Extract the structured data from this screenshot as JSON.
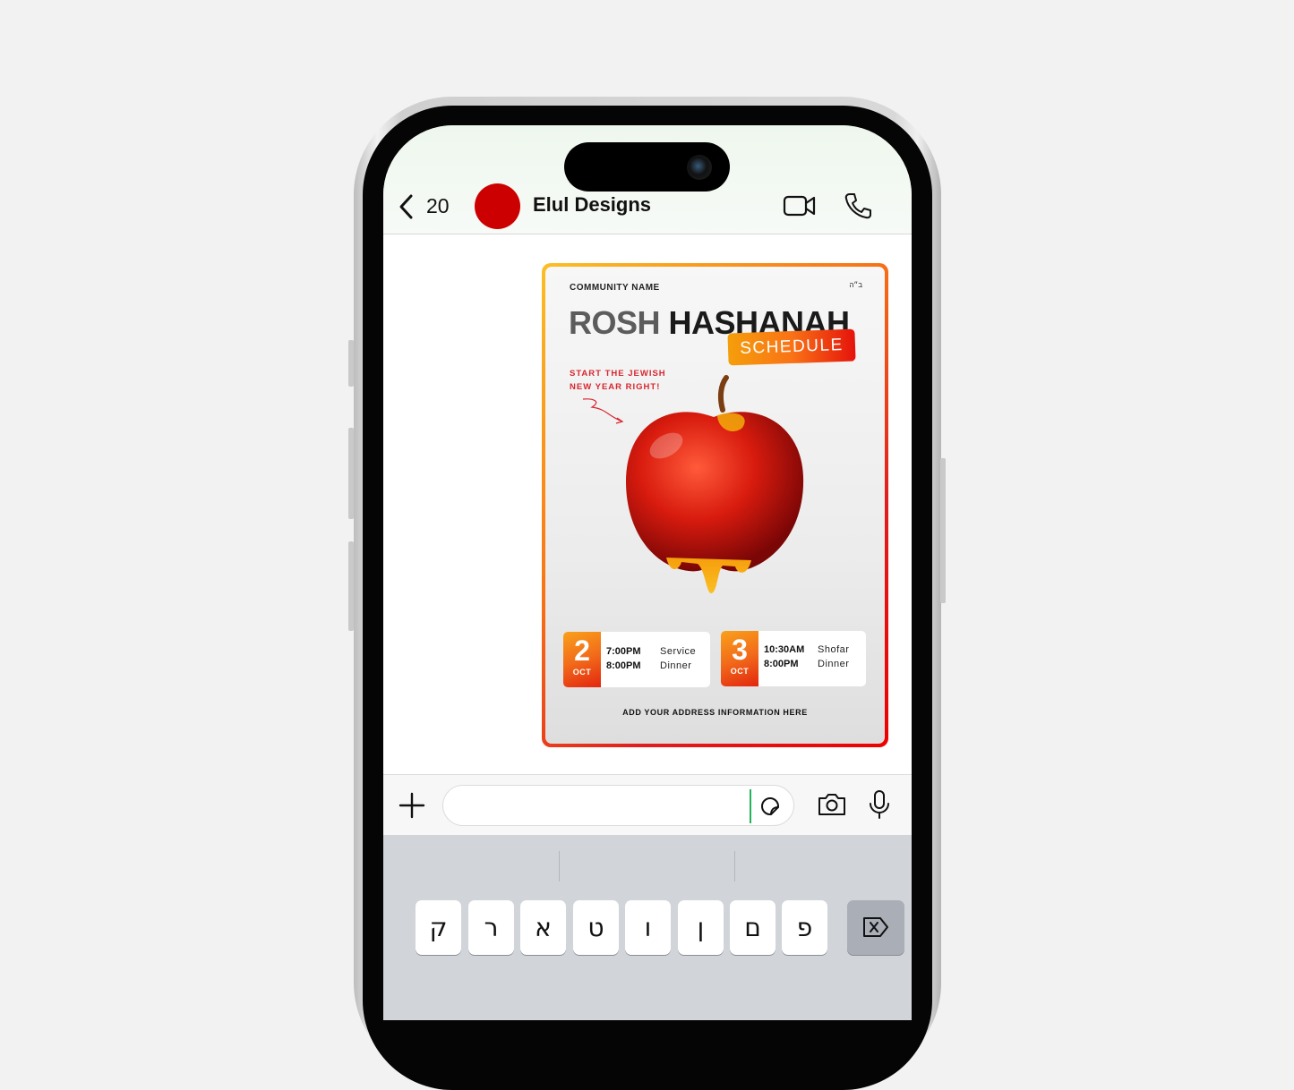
{
  "header": {
    "back_count": "20",
    "contact_name": "Elul Designs",
    "avatar_color": "#cc0000",
    "icons": [
      "chevron-left-icon",
      "video-camera-icon",
      "phone-icon"
    ]
  },
  "message": {
    "community": "COMMUNITY NAME",
    "bh": "ב״ה",
    "title_part1": "ROSH ",
    "title_part2": "HASHANAH",
    "badge": "SCHEDULE",
    "tagline1": "START THE JEWISH",
    "tagline2": "NEW YEAR RIGHT!",
    "days": [
      {
        "day": "2",
        "month": "OCT",
        "events": [
          {
            "time": "7:00PM",
            "label": "Service"
          },
          {
            "time": "8:00PM",
            "label": "Dinner"
          }
        ]
      },
      {
        "day": "3",
        "month": "OCT",
        "events": [
          {
            "time": "10:30AM",
            "label": "Shofar"
          },
          {
            "time": "8:00PM",
            "label": "Dinner"
          }
        ]
      }
    ],
    "address": "ADD YOUR ADDRESS INFORMATION HERE"
  },
  "composer": {
    "value": "",
    "icons": [
      "plus-icon",
      "sticker-icon",
      "camera-icon",
      "microphone-icon"
    ]
  },
  "keyboard": {
    "row1": [
      "ק",
      "ר",
      "א",
      "ט",
      "ו",
      "ן",
      "ם",
      "פ"
    ],
    "delete_icon": "backspace-icon"
  }
}
